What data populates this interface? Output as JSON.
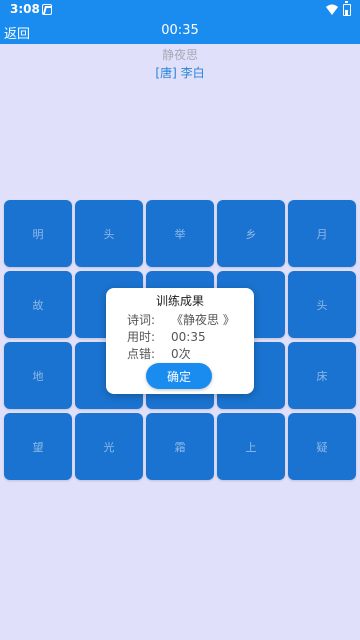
{
  "status_bar": {
    "time": "3:08"
  },
  "header": {
    "back_label": "返回",
    "timer": "00:35"
  },
  "poem": {
    "title": "静夜思",
    "author": "[唐] 李白"
  },
  "tiles": [
    "明",
    "头",
    "举",
    "乡",
    "月",
    "故",
    "",
    "",
    "",
    "头",
    "地",
    "",
    "",
    "",
    "床",
    "望",
    "光",
    "霜",
    "上",
    "疑"
  ],
  "modal": {
    "title": "训练成果",
    "poem_label": "诗词:",
    "poem_value": "《静夜思 》",
    "time_label": "用时:",
    "time_value": "00:35",
    "error_label": "点错:",
    "error_value": "0次",
    "confirm_label": "确定"
  }
}
